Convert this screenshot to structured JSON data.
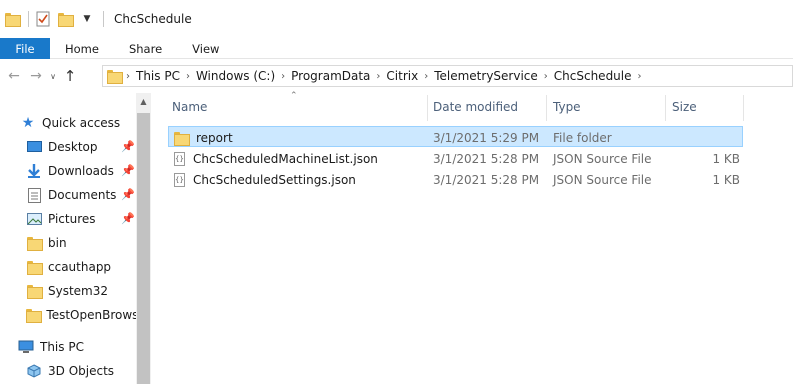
{
  "window": {
    "title": "ChcSchedule"
  },
  "ribbon": {
    "tabs": [
      "File",
      "Home",
      "Share",
      "View"
    ]
  },
  "address": {
    "crumbs": [
      "This PC",
      "Windows (C:)",
      "ProgramData",
      "Citrix",
      "TelemetryService",
      "ChcSchedule"
    ]
  },
  "nav": {
    "items": [
      {
        "label": "Quick access",
        "icon": "star-icon"
      },
      {
        "label": "Desktop",
        "icon": "desktop-icon",
        "pinned": true
      },
      {
        "label": "Downloads",
        "icon": "download-icon",
        "pinned": true
      },
      {
        "label": "Documents",
        "icon": "documents-icon",
        "pinned": true
      },
      {
        "label": "Pictures",
        "icon": "pictures-icon",
        "pinned": true
      },
      {
        "label": "bin",
        "icon": "folder-icon"
      },
      {
        "label": "ccauthapp",
        "icon": "folder-icon"
      },
      {
        "label": "System32",
        "icon": "folder-icon"
      },
      {
        "label": "TestOpenBrowse",
        "icon": "folder-icon"
      },
      {
        "label": "This PC",
        "icon": "computer-icon"
      },
      {
        "label": "3D Objects",
        "icon": "cube-icon"
      }
    ]
  },
  "columns": {
    "name": "Name",
    "date": "Date modified",
    "type": "Type",
    "size": "Size"
  },
  "files": [
    {
      "name": "report",
      "date": "3/1/2021 5:29 PM",
      "type": "File folder",
      "size": "",
      "kind": "folder",
      "selected": true
    },
    {
      "name": "ChcScheduledMachineList.json",
      "date": "3/1/2021 5:28 PM",
      "type": "JSON Source File",
      "size": "1 KB",
      "kind": "file"
    },
    {
      "name": "ChcScheduledSettings.json",
      "date": "3/1/2021 5:28 PM",
      "type": "JSON Source File",
      "size": "1 KB",
      "kind": "file"
    }
  ],
  "colors": {
    "accent": "#1979ca",
    "selection": "#cce8ff",
    "selection_border": "#99d1ff",
    "folder": "#f8d775"
  }
}
